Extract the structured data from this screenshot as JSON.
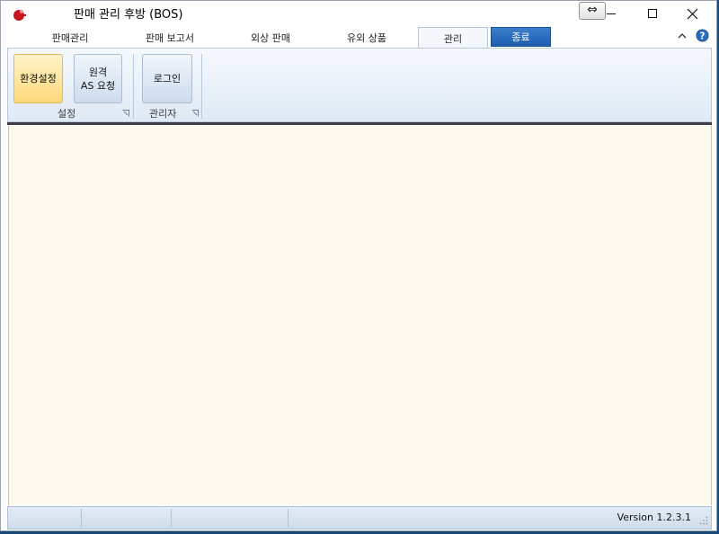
{
  "window": {
    "title": "판매 관리 후방 (BOS)",
    "restore_glyph": "⇔",
    "controls": [
      "minimize-icon",
      "maximize-icon",
      "close-icon"
    ]
  },
  "tabs": [
    {
      "label": "판매관리",
      "active": false
    },
    {
      "label": "판매 보고서",
      "active": false
    },
    {
      "label": "외상 판매",
      "active": false
    },
    {
      "label": "유외 상품",
      "active": false
    },
    {
      "label": "관리",
      "active": true
    },
    {
      "label": "종료",
      "active": false,
      "style": "exit"
    }
  ],
  "ribbon": {
    "groups": [
      {
        "label": "설정",
        "buttons": [
          {
            "label": "환경설정",
            "highlighted": true
          },
          {
            "label_line1": "원격",
            "label_line2": "AS 요청",
            "highlighted": false
          }
        ]
      },
      {
        "label": "관리자",
        "buttons": [
          {
            "label": "로그인",
            "highlighted": false
          }
        ]
      }
    ]
  },
  "statusbar": {
    "version": "Version 1.2.3.1"
  },
  "colors": {
    "main_background": "#fdf9ec",
    "exit_tab": "#2a6dbf",
    "highlight_button": "#ffd97a"
  }
}
